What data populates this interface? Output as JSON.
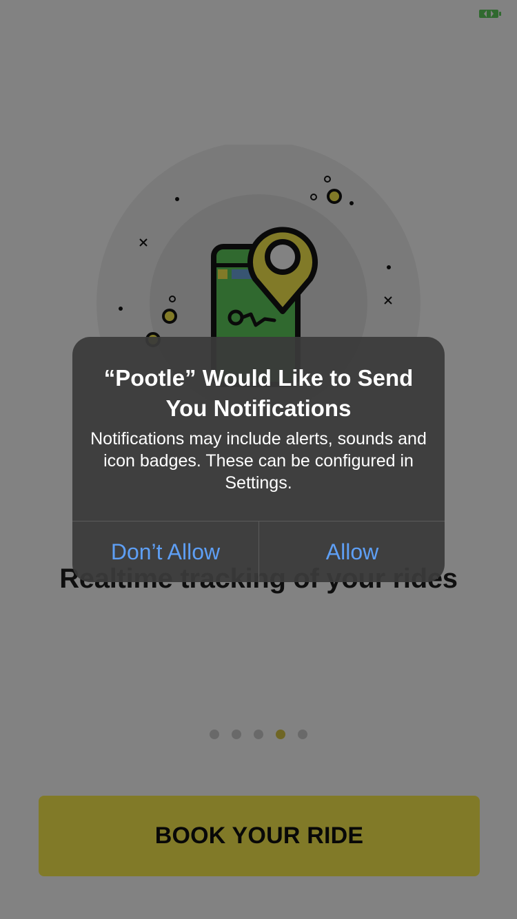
{
  "onboarding": {
    "title": "Realtime tracking of your rides",
    "pager": {
      "total": 5,
      "active_index": 3
    },
    "cta_label": "BOOK YOUR RIDE"
  },
  "alert": {
    "title": "“Pootle” Would Like to Send You Notifications",
    "message": "Notifications may include alerts, sounds and icon badges. These can be configured in Settings.",
    "deny_label": "Don’t Allow",
    "allow_label": "Allow"
  },
  "icons": {
    "status_bar": "battery-icon",
    "illustration": "phone-location-pin-illustration"
  },
  "colors": {
    "accent_yellow": "#fdf04f",
    "illustration_green": "#5fcf5c",
    "alert_button_blue": "#5e9ff5"
  }
}
